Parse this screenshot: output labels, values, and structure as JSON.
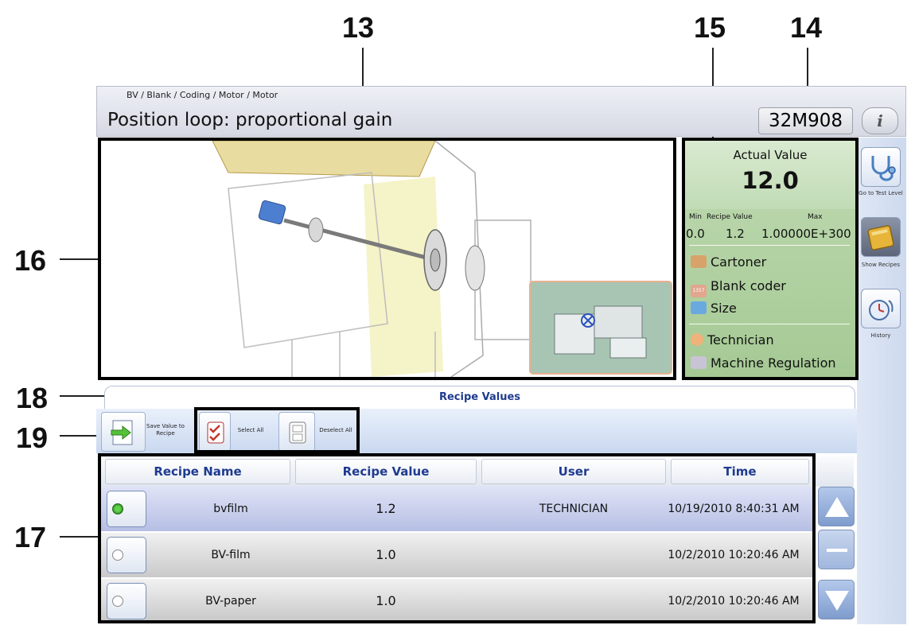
{
  "callouts": [
    "13",
    "15",
    "14",
    "16",
    "18",
    "19",
    "17"
  ],
  "header": {
    "breadcrumb": "BV / Blank / Coding / Motor / Motor",
    "title": "Position loop: proportional gain",
    "code": "32M908",
    "info": "i"
  },
  "side_buttons": [
    {
      "label": "Go to Test Level",
      "icon": "stethoscope-icon"
    },
    {
      "label": "Show Recipes",
      "icon": "book-icon"
    },
    {
      "label": "History",
      "icon": "clock-history-icon"
    }
  ],
  "value_panel": {
    "actual_label": "Actual Value",
    "actual_value": "12.0",
    "min_label": "Min",
    "recipe_label": "Recipe Value",
    "max_label": "Max",
    "min_value": "0.0",
    "recipe_value": "1.2",
    "max_value": "1.00000E+300",
    "items": [
      "Cartoner",
      "Blank coder",
      "Size"
    ],
    "users": [
      "Technician",
      "Machine Regulation"
    ],
    "coder_icon_text": "1357"
  },
  "recipe": {
    "tab_title": "Recipe Values",
    "save_label": "Save Value to Recipe",
    "select_all_label": "Select All",
    "deselect_all_label": "Deselect All",
    "columns": [
      "Recipe Name",
      "Recipe Value",
      "User",
      "Time"
    ],
    "rows": [
      {
        "name": "bvfilm",
        "value": "1.2",
        "user": "TECHNICIAN",
        "time": "10/19/2010 8:40:31 AM",
        "selected": true
      },
      {
        "name": "BV-film",
        "value": "1.0",
        "user": "",
        "time": "10/2/2010 10:20:46 AM",
        "selected": false
      },
      {
        "name": "BV-paper",
        "value": "1.0",
        "user": "",
        "time": "10/2/2010 10:20:46 AM",
        "selected": false
      }
    ]
  },
  "colors": {
    "accent_blue": "#1f3b8f",
    "panel_green": "#bfdab2",
    "selected_row": "#c4cbeb"
  }
}
